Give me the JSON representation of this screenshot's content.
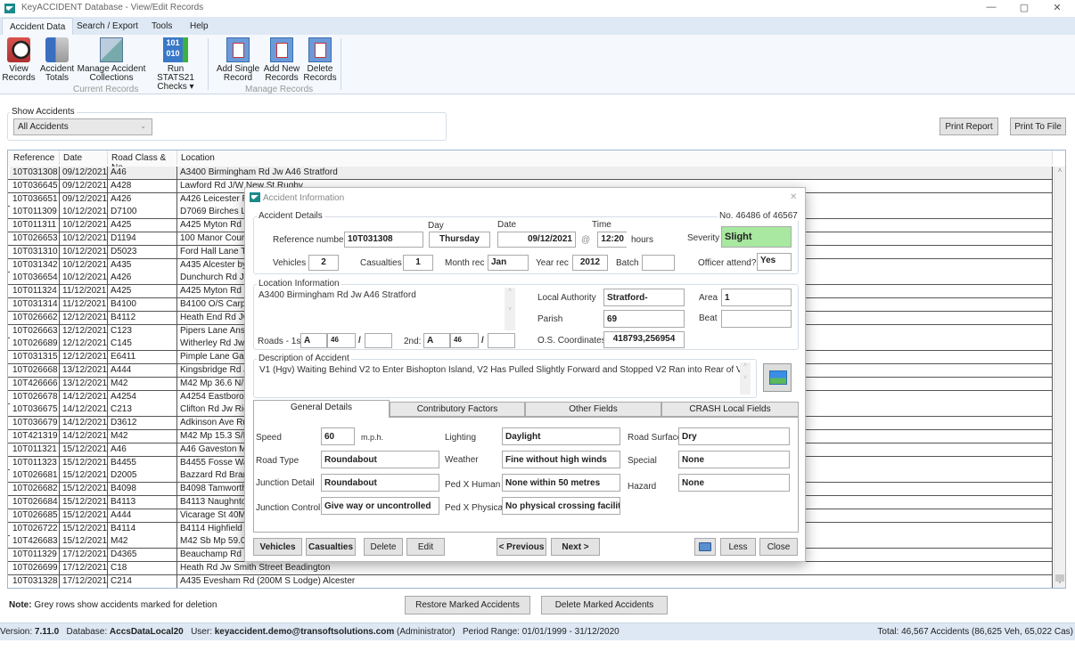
{
  "window": {
    "title": "KeyACCIDENT Database - View/Edit Records",
    "minimize": "—",
    "maximize": "▢",
    "close": "✕"
  },
  "ribbon_tabs": [
    "Accident Data",
    "Search / Export",
    "Tools",
    "Help"
  ],
  "ribbon": {
    "buttons": [
      {
        "line1": "View",
        "line2": "Records",
        "icon": "view-records-icon"
      },
      {
        "line1": "Accident",
        "line2": "Totals",
        "icon": "accident-totals-icon"
      },
      {
        "line1": "Manage Accident",
        "line2": "Collections",
        "icon": "collections-icon"
      },
      {
        "line1": "Run STATS21",
        "line2": "Checks ▾",
        "icon": "stats21-checks-icon"
      },
      {
        "line1": "Add Single",
        "line2": "Record",
        "icon": "add-single-record-icon"
      },
      {
        "line1": "Add New",
        "line2": "Records",
        "icon": "add-new-records-icon"
      },
      {
        "line1": "Delete",
        "line2": "Records",
        "icon": "delete-records-icon"
      }
    ],
    "groups": [
      "Current Records",
      "Manage Records"
    ]
  },
  "filter": {
    "label": "Show Accidents",
    "selected": "All Accidents"
  },
  "print_report": "Print Report",
  "print_to_file": "Print To File",
  "table": {
    "columns": [
      "Reference",
      "Date",
      "Road Class & No",
      "Location"
    ],
    "rows": [
      [
        "10T031308",
        "09/12/2021",
        "A46",
        "A3400 Birmingham Rd Jw A46 Stratford"
      ],
      [
        "10T036645",
        "09/12/2021",
        "A428",
        "Lawford Rd J/W New St Rugby"
      ],
      [
        "10T036651",
        "09/12/2021",
        "A426",
        "A426 Leicester Rd"
      ],
      [
        "10T011309",
        "10/12/2021",
        "D7100",
        "D7069 Birches Lane"
      ],
      [
        "10T011311",
        "10/12/2021",
        "A425",
        "A425 Myton Rd Jw"
      ],
      [
        "10T026653",
        "10/12/2021",
        "D1194",
        "100 Manor Court"
      ],
      [
        "10T031310",
        "10/12/2021",
        "D5023",
        "Ford Hall Lane Tan"
      ],
      [
        "10T031342",
        "10/12/2021",
        "A435",
        "A435 Alcester by"
      ],
      [
        "10T036654",
        "10/12/2021",
        "A426",
        "Dunchurch Rd Jw"
      ],
      [
        "10T011324",
        "11/12/2021",
        "A425",
        "A425 Myton Rd L"
      ],
      [
        "10T031314",
        "11/12/2021",
        "B4100",
        "B4100 O/S Carpe"
      ],
      [
        "10T026662",
        "12/12/2021",
        "B4112",
        "Heath End Rd Jw"
      ],
      [
        "10T026663",
        "12/12/2021",
        "C123",
        "Pipers Lane Ansle"
      ],
      [
        "10T026689",
        "12/12/2021",
        "C145",
        "Witherley Rd Jw C"
      ],
      [
        "10T031315",
        "12/12/2021",
        "E6411",
        "Pimple Lane Gayd"
      ],
      [
        "10T026668",
        "13/12/2021",
        "A444",
        "Kingsbridge Rd J/"
      ],
      [
        "10T426666",
        "13/12/2021",
        "M42",
        "M42 Mp 36.6 N/B"
      ],
      [
        "10T026678",
        "14/12/2021",
        "A4254",
        "A4254 Eastboro W"
      ],
      [
        "10T036675",
        "14/12/2021",
        "C213",
        "Clifton Rd Jw Ridg"
      ],
      [
        "10T036679",
        "14/12/2021",
        "D3612",
        "Adkinson Ave Rug"
      ],
      [
        "10T421319",
        "14/12/2021",
        "M42",
        "M42 Mp 15.3 S/B"
      ],
      [
        "10T011321",
        "15/12/2021",
        "A46",
        "A46 Gaveston Mp"
      ],
      [
        "10T011323",
        "15/12/2021",
        "B4455",
        "B4455 Fosse Way"
      ],
      [
        "10T026681",
        "15/12/2021",
        "D2005",
        "Bazzard Rd Bramc"
      ],
      [
        "10T026682",
        "15/12/2021",
        "B4098",
        "B4098 Tamworth"
      ],
      [
        "10T026684",
        "15/12/2021",
        "B4113",
        "B4113 Naughnton"
      ],
      [
        "10T026685",
        "15/12/2021",
        "A444",
        "Vicarage St 40M W"
      ],
      [
        "10T026722",
        "15/12/2021",
        "B4114",
        "B4114 Highfield R"
      ],
      [
        "10T426683",
        "15/12/2021",
        "M42",
        "M42 Sb Mp 59.0"
      ],
      [
        "10T011329",
        "17/12/2021",
        "D4365",
        "Beauchamp Rd Jw"
      ],
      [
        "10T026699",
        "17/12/2021",
        "C18",
        "Heath Rd Jw Smith Street Beadington"
      ],
      [
        "10T031328",
        "17/12/2021",
        "C214",
        "A435 Evesham Rd (200M S Lodge) Alcester"
      ]
    ]
  },
  "dialog": {
    "title": "Accident Information",
    "close": "✕",
    "record_counter": "No. 46486 of 46567",
    "details": {
      "group": "Accident Details",
      "reference_label": "Reference number",
      "reference": "10T031308",
      "day_label": "Day",
      "day": "Thursday",
      "date_label": "Date",
      "date": "09/12/2021",
      "at": "@",
      "time_label": "Time",
      "time": "12:20",
      "hours": "hours",
      "severity_label": "Severity",
      "severity": "Slight",
      "vehicles_label": "Vehicles",
      "vehicles": "2",
      "casualties_label": "Casualties",
      "casualties": "1",
      "month_label": "Month rec",
      "month": "Jan",
      "year_label": "Year rec",
      "year": "2012",
      "batch_label": "Batch",
      "batch": "",
      "officer_label": "Officer attend?",
      "officer": "Yes"
    },
    "location": {
      "group": "Location Information",
      "text": "A3400 Birmingham Rd Jw A46 Stratford",
      "roads1_label": "Roads - 1st",
      "r1_class": "A",
      "r1_num": "46",
      "r1_sep": "/",
      "r1_extra": "",
      "roads2_label": "2nd:",
      "r2_class": "A",
      "r2_num": "46",
      "r2_sep": "/",
      "r2_extra": "",
      "la_label": "Local Authority",
      "la": "Stratford-",
      "area_label": "Area",
      "area": "1",
      "parish_label": "Parish",
      "parish": "69",
      "beat_label": "Beat",
      "beat": "",
      "os_label": "O.S. Coordinates",
      "os": "418793,256954"
    },
    "description": {
      "group": "Description of Accident",
      "text": "V1 (Hgv) Waiting Behind V2 to Enter Bishopton Island, V2 Has Pulled Slightly Forward and Stopped V2 Ran into Rear of V2"
    },
    "tabs": [
      "General Details",
      "Contributory Factors",
      "Other Fields",
      "CRASH Local Fields"
    ],
    "general": {
      "speed_label": "Speed",
      "speed": "60",
      "mph": "m.p.h.",
      "road_type_label": "Road Type",
      "road_type": "Roundabout",
      "junction_detail_label": "Junction Detail",
      "junction_detail": "Roundabout",
      "junction_control_label": "Junction Control",
      "junction_control": "Give way or uncontrolled",
      "lighting_label": "Lighting",
      "lighting": "Daylight",
      "weather_label": "Weather",
      "weather": "Fine without high winds",
      "pedx_human_label": "Ped X Human",
      "pedx_human": "None within 50 metres",
      "pedx_physical_label": "Ped X Physical",
      "pedx_physical": "No physical crossing facility w",
      "road_surface_label": "Road Surface",
      "road_surface": "Dry",
      "special_label": "Special",
      "special": "None",
      "hazard_label": "Hazard",
      "hazard": "None"
    },
    "buttons": {
      "vehicles": "Vehicles",
      "casualties": "Casualties",
      "delete": "Delete",
      "edit": "Edit",
      "previous": "< Previous",
      "next": "Next >",
      "less": "Less",
      "close": "Close"
    }
  },
  "note": {
    "bold": "Note:",
    "text": " Grey rows show accidents marked for deletion"
  },
  "restore_marked": "Restore Marked Accidents",
  "delete_marked": "Delete Marked Accidents",
  "status": {
    "version_label": "Version: ",
    "version": "7.11.0",
    "db_label": "Database: ",
    "db": "AccsDataLocal20",
    "user_label": "User: ",
    "user": "keyaccident.demo@transoftsolutions.com",
    "role": " (Administrator)",
    "period": "Period Range: 01/01/1999 - 31/12/2020",
    "total": "Total: 46,567 Accidents (86,625 Veh, 65,022 Cas)"
  },
  "colors": {
    "severity_slight": "#a8e8a0",
    "ribbon_bg": "#f5f8fc",
    "status_bg": "#dde8f4"
  }
}
